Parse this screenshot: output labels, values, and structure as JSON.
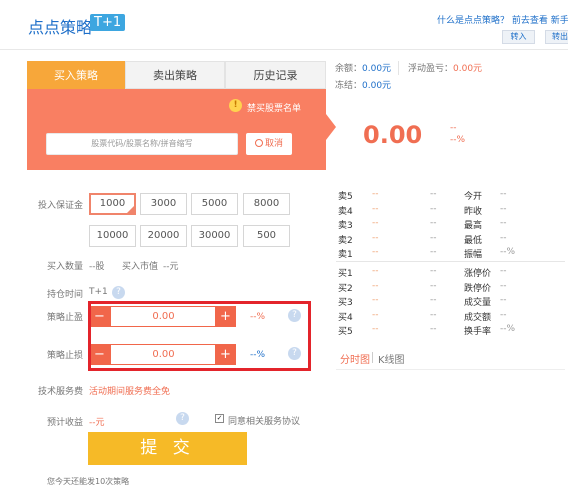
{
  "header": {
    "title": "点点策略",
    "badge": "T+1",
    "help_text": "什么是点点策略？ 前去查看 新手",
    "btn_in": "转入",
    "btn_out": "转出"
  },
  "account": {
    "balance_label": "余额：",
    "balance_value": "0.00元",
    "frozen_label": "冻结：",
    "frozen_value": "0.00元",
    "pnl_label": "浮动盈亏：",
    "pnl_value": "0.00元"
  },
  "tabs": [
    "买入策略",
    "卖出策略",
    "历史记录"
  ],
  "search": {
    "forbid_link": "禁买股票名单",
    "placeholder": "股票代码/股票名称/拼音缩写",
    "cancel": "取消"
  },
  "form": {
    "margin_label": "投入保证金",
    "amounts": [
      "1000",
      "3000",
      "5000",
      "8000",
      "10000",
      "20000",
      "30000",
      "500"
    ],
    "buy_qty_label": "买入数量",
    "buy_qty_value": "--股",
    "buy_value_label": "买入市值",
    "buy_value_value": "--元",
    "hold_label": "持仓时间",
    "hold_value": "T+1",
    "take_profit_label": "策略止盈",
    "take_profit_value": "0.00",
    "take_profit_pct": "--%",
    "stop_loss_label": "策略止损",
    "stop_loss_value": "0.00",
    "stop_loss_pct": "--%",
    "fee_label": "技术服务费",
    "fee_value": "活动期间服务费全免",
    "expected_label": "预计收益",
    "expected_value": "--元",
    "agree_label": "同意相关服务协议",
    "submit": "提 交",
    "remaining": "您今天还能发10次策略"
  },
  "quote": {
    "price": "0.00",
    "change": "--",
    "change_pct": "--%",
    "asks": [
      {
        "label": "卖5",
        "price": "--",
        "vol": "--"
      },
      {
        "label": "卖4",
        "price": "--",
        "vol": "--"
      },
      {
        "label": "卖3",
        "price": "--",
        "vol": "--"
      },
      {
        "label": "卖2",
        "price": "--",
        "vol": "--"
      },
      {
        "label": "卖1",
        "price": "--",
        "vol": "--"
      }
    ],
    "bids": [
      {
        "label": "买1",
        "price": "--",
        "vol": "--"
      },
      {
        "label": "买2",
        "price": "--",
        "vol": "--"
      },
      {
        "label": "买3",
        "price": "--",
        "vol": "--"
      },
      {
        "label": "买4",
        "price": "--",
        "vol": "--"
      },
      {
        "label": "买5",
        "price": "--",
        "vol": "--"
      }
    ],
    "stats_top": [
      {
        "label": "今开",
        "value": "--"
      },
      {
        "label": "昨收",
        "value": "--"
      },
      {
        "label": "最高",
        "value": "--"
      },
      {
        "label": "最低",
        "value": "--"
      },
      {
        "label": "振幅",
        "value": "--%"
      }
    ],
    "stats_bottom": [
      {
        "label": "涨停价",
        "value": "--"
      },
      {
        "label": "跌停价",
        "value": "--"
      },
      {
        "label": "成交量",
        "value": "--"
      },
      {
        "label": "成交额",
        "value": "--"
      },
      {
        "label": "换手率",
        "value": "--%"
      }
    ],
    "tab_fenshi": "分时图",
    "tab_kline": "K线图"
  },
  "colors": {
    "accent_orange": "#f97f62",
    "tab_active": "#f7a73a",
    "submit": "#f6ba27",
    "highlight_frame": "#e3242b"
  }
}
